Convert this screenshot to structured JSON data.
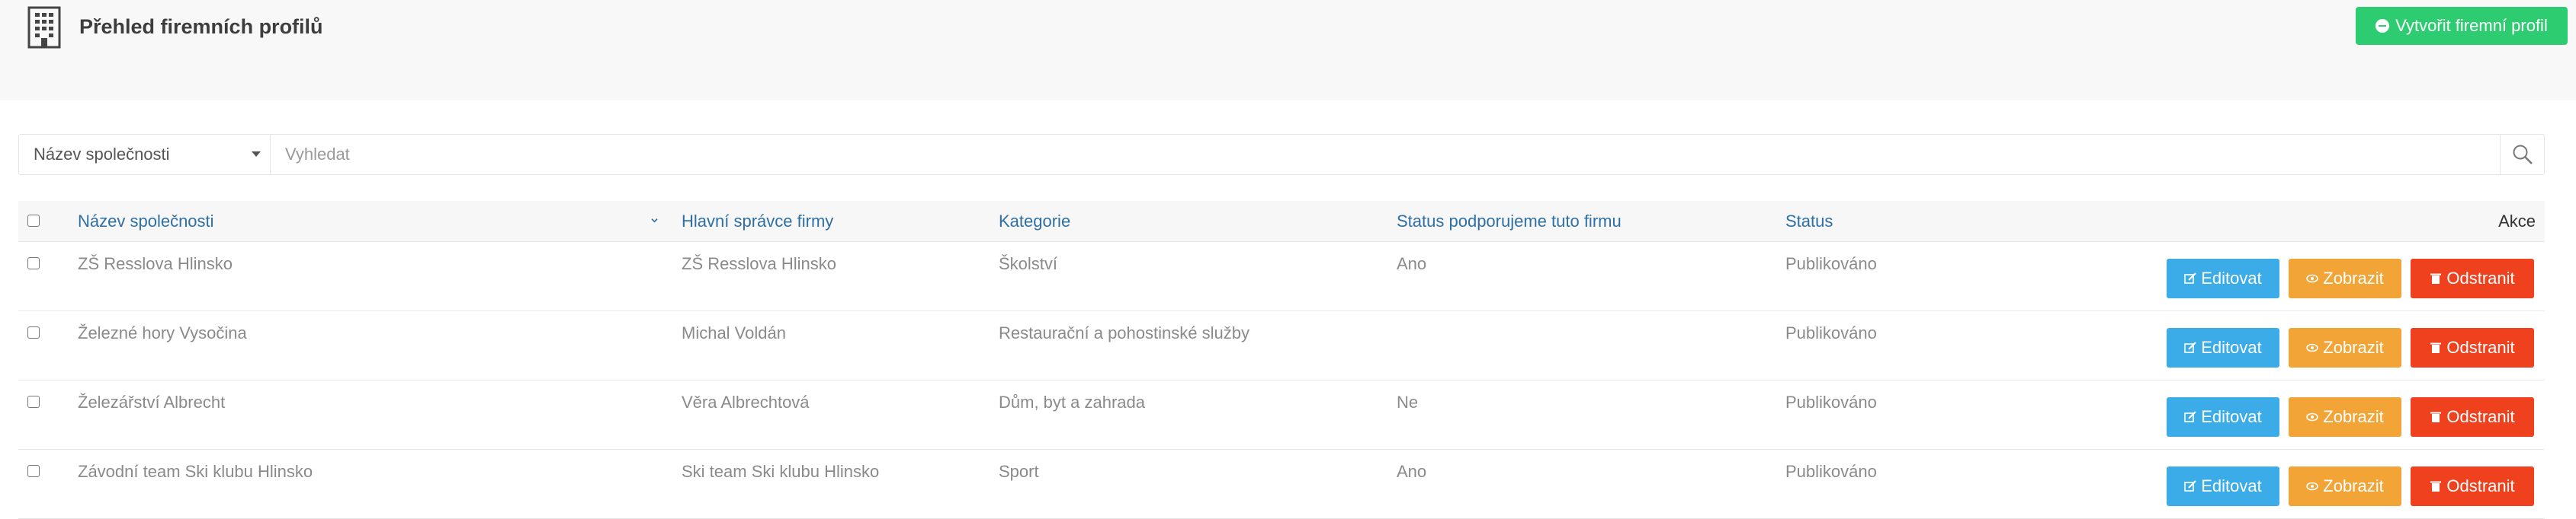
{
  "header": {
    "title": "Přehled firemních profilů",
    "create_button": "Vytvořit firemní profil"
  },
  "search": {
    "field_select": "Název společnosti",
    "placeholder": "Vyhledat"
  },
  "table": {
    "columns": {
      "name": "Název společnosti",
      "admin": "Hlavní správce firmy",
      "category": "Kategorie",
      "support": "Status podporujeme tuto firmu",
      "status": "Status",
      "actions": "Akce"
    },
    "rows": [
      {
        "name": "ZŠ Resslova Hlinsko",
        "admin": "ZŠ Resslova Hlinsko",
        "category": "Školství",
        "support": "Ano",
        "status": "Publikováno"
      },
      {
        "name": "Železné hory Vysočina",
        "admin": "Michal Voldán",
        "category": "Restaurační a pohostinské služby",
        "support": "",
        "status": "Publikováno"
      },
      {
        "name": "Železářství Albrecht",
        "admin": "Věra Albrechtová",
        "category": "Dům, byt a zahrada",
        "support": "Ne",
        "status": "Publikováno"
      },
      {
        "name": "Závodní team Ski klubu Hlinsko",
        "admin": "Ski team Ski klubu Hlinsko",
        "category": "Sport",
        "support": "Ano",
        "status": "Publikováno"
      }
    ],
    "buttons": {
      "edit": "Editovat",
      "view": "Zobrazit",
      "delete": "Odstranit"
    }
  },
  "colors": {
    "create": "#2ecc71",
    "edit": "#3bace8",
    "view": "#f2a436",
    "delete": "#f0411f",
    "header_link": "#2f6fa3"
  },
  "icons": [
    "building-icon",
    "plus-circle-icon",
    "caret-down-icon",
    "search-icon",
    "sort-chevron-icon",
    "edit-icon",
    "eye-icon",
    "trash-icon"
  ]
}
